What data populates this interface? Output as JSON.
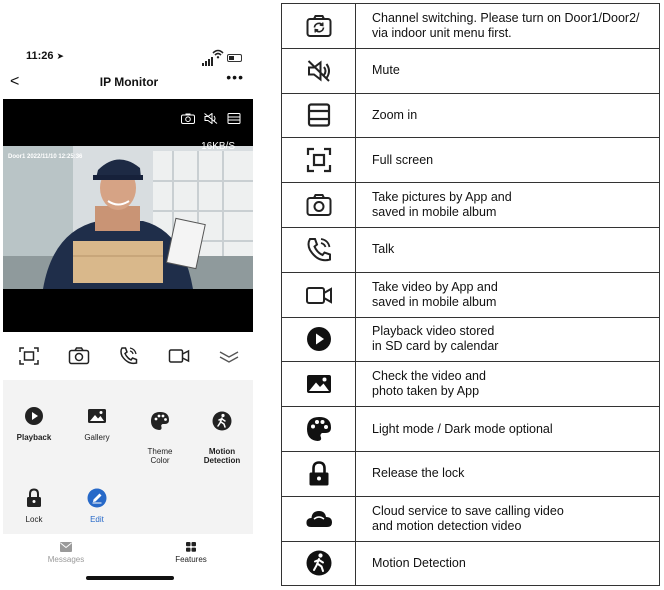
{
  "status_bar": {
    "time": "11:26"
  },
  "nav": {
    "back": "<",
    "title": "IP Monitor",
    "more": "•••"
  },
  "video": {
    "rate": "16KB/S",
    "timestamp": "Door1 2022/11/10 12:25:36"
  },
  "features": {
    "playback": "Playback",
    "gallery": "Gallery",
    "theme_color": "Theme\nColor",
    "motion_detection": "Motion\nDetection",
    "lock": "Lock",
    "edit": "Edit"
  },
  "tabs": {
    "messages": "Messages",
    "features": "Features"
  },
  "colors": {
    "accent": "#2769c8",
    "panel_bg": "#f3f3f3",
    "video_bg": "#000000"
  },
  "legend": [
    {
      "icon": "camera-switch-icon",
      "text": "Channel switching. Please turn on Door1/Door2/\nvia indoor unit menu first."
    },
    {
      "icon": "mute-icon",
      "text": "Mute"
    },
    {
      "icon": "zoom-in-icon",
      "text": "Zoom in"
    },
    {
      "icon": "full-screen-icon",
      "text": "Full screen"
    },
    {
      "icon": "camera-icon",
      "text": "Take pictures by App and\nsaved in mobile album"
    },
    {
      "icon": "talk-icon",
      "text": "Talk"
    },
    {
      "icon": "video-camera-icon",
      "text": "Take video by App and\nsaved in mobile album"
    },
    {
      "icon": "play-icon",
      "text": "Playback video stored\nin SD card by calendar"
    },
    {
      "icon": "gallery-icon",
      "text": "Check the video and\nphoto taken by App"
    },
    {
      "icon": "palette-icon",
      "text": "Light mode / Dark mode optional"
    },
    {
      "icon": "lock-icon",
      "text": "Release the lock"
    },
    {
      "icon": "cloud-icon",
      "text": "Cloud service to save calling video\nand motion detection video"
    },
    {
      "icon": "motion-icon",
      "text": "Motion Detection"
    }
  ]
}
